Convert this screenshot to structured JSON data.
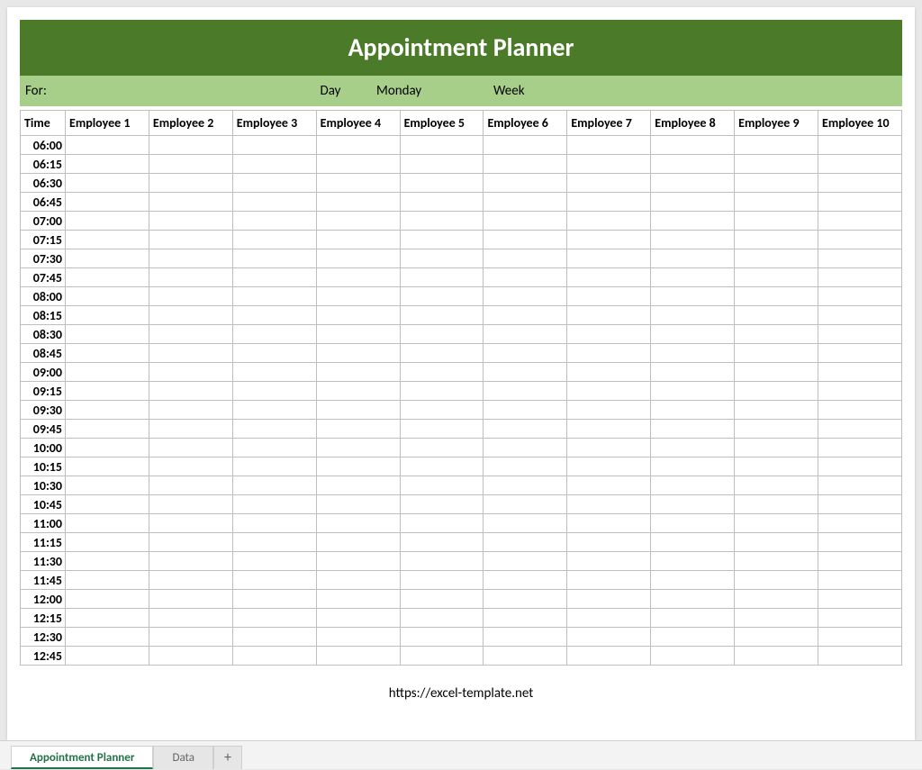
{
  "header": {
    "title": "Appointment Planner"
  },
  "info": {
    "for_label": "For:",
    "day_label": "Day",
    "day_value": "Monday",
    "week_label": "Week"
  },
  "columns": {
    "time": "Time",
    "emp": [
      "Employee 1",
      "Employee 2",
      "Employee 3",
      "Employee 4",
      "Employee 5",
      "Employee 6",
      "Employee 7",
      "Employee 8",
      "Employee 9",
      "Employee 10"
    ]
  },
  "times": [
    "06:00",
    "06:15",
    "06:30",
    "06:45",
    "07:00",
    "07:15",
    "07:30",
    "07:45",
    "08:00",
    "08:15",
    "08:30",
    "08:45",
    "09:00",
    "09:15",
    "09:30",
    "09:45",
    "10:00",
    "10:15",
    "10:30",
    "10:45",
    "11:00",
    "11:15",
    "11:30",
    "11:45",
    "12:00",
    "12:15",
    "12:30",
    "12:45"
  ],
  "footer": {
    "url": "https://excel-template.net"
  },
  "tabs": {
    "active": "Appointment Planner",
    "secondary": "Data",
    "add": "+"
  }
}
